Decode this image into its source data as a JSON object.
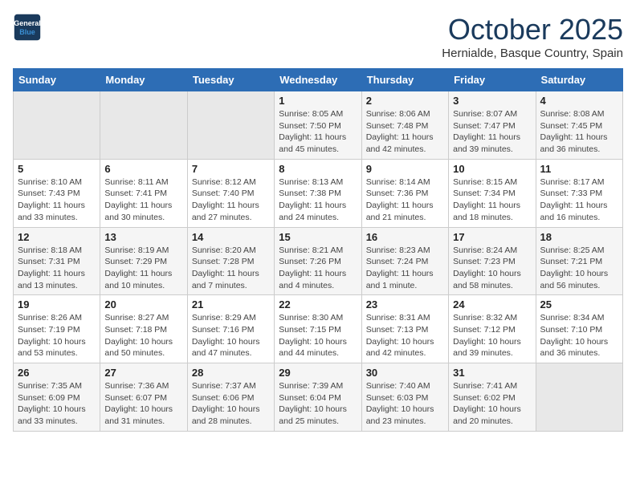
{
  "logo": {
    "line1": "General",
    "line2": "Blue"
  },
  "title": "October 2025",
  "subtitle": "Hernialde, Basque Country, Spain",
  "days_of_week": [
    "Sunday",
    "Monday",
    "Tuesday",
    "Wednesday",
    "Thursday",
    "Friday",
    "Saturday"
  ],
  "weeks": [
    [
      {
        "day": "",
        "info": ""
      },
      {
        "day": "",
        "info": ""
      },
      {
        "day": "",
        "info": ""
      },
      {
        "day": "1",
        "info": "Sunrise: 8:05 AM\nSunset: 7:50 PM\nDaylight: 11 hours\nand 45 minutes."
      },
      {
        "day": "2",
        "info": "Sunrise: 8:06 AM\nSunset: 7:48 PM\nDaylight: 11 hours\nand 42 minutes."
      },
      {
        "day": "3",
        "info": "Sunrise: 8:07 AM\nSunset: 7:47 PM\nDaylight: 11 hours\nand 39 minutes."
      },
      {
        "day": "4",
        "info": "Sunrise: 8:08 AM\nSunset: 7:45 PM\nDaylight: 11 hours\nand 36 minutes."
      }
    ],
    [
      {
        "day": "5",
        "info": "Sunrise: 8:10 AM\nSunset: 7:43 PM\nDaylight: 11 hours\nand 33 minutes."
      },
      {
        "day": "6",
        "info": "Sunrise: 8:11 AM\nSunset: 7:41 PM\nDaylight: 11 hours\nand 30 minutes."
      },
      {
        "day": "7",
        "info": "Sunrise: 8:12 AM\nSunset: 7:40 PM\nDaylight: 11 hours\nand 27 minutes."
      },
      {
        "day": "8",
        "info": "Sunrise: 8:13 AM\nSunset: 7:38 PM\nDaylight: 11 hours\nand 24 minutes."
      },
      {
        "day": "9",
        "info": "Sunrise: 8:14 AM\nSunset: 7:36 PM\nDaylight: 11 hours\nand 21 minutes."
      },
      {
        "day": "10",
        "info": "Sunrise: 8:15 AM\nSunset: 7:34 PM\nDaylight: 11 hours\nand 18 minutes."
      },
      {
        "day": "11",
        "info": "Sunrise: 8:17 AM\nSunset: 7:33 PM\nDaylight: 11 hours\nand 16 minutes."
      }
    ],
    [
      {
        "day": "12",
        "info": "Sunrise: 8:18 AM\nSunset: 7:31 PM\nDaylight: 11 hours\nand 13 minutes."
      },
      {
        "day": "13",
        "info": "Sunrise: 8:19 AM\nSunset: 7:29 PM\nDaylight: 11 hours\nand 10 minutes."
      },
      {
        "day": "14",
        "info": "Sunrise: 8:20 AM\nSunset: 7:28 PM\nDaylight: 11 hours\nand 7 minutes."
      },
      {
        "day": "15",
        "info": "Sunrise: 8:21 AM\nSunset: 7:26 PM\nDaylight: 11 hours\nand 4 minutes."
      },
      {
        "day": "16",
        "info": "Sunrise: 8:23 AM\nSunset: 7:24 PM\nDaylight: 11 hours\nand 1 minute."
      },
      {
        "day": "17",
        "info": "Sunrise: 8:24 AM\nSunset: 7:23 PM\nDaylight: 10 hours\nand 58 minutes."
      },
      {
        "day": "18",
        "info": "Sunrise: 8:25 AM\nSunset: 7:21 PM\nDaylight: 10 hours\nand 56 minutes."
      }
    ],
    [
      {
        "day": "19",
        "info": "Sunrise: 8:26 AM\nSunset: 7:19 PM\nDaylight: 10 hours\nand 53 minutes."
      },
      {
        "day": "20",
        "info": "Sunrise: 8:27 AM\nSunset: 7:18 PM\nDaylight: 10 hours\nand 50 minutes."
      },
      {
        "day": "21",
        "info": "Sunrise: 8:29 AM\nSunset: 7:16 PM\nDaylight: 10 hours\nand 47 minutes."
      },
      {
        "day": "22",
        "info": "Sunrise: 8:30 AM\nSunset: 7:15 PM\nDaylight: 10 hours\nand 44 minutes."
      },
      {
        "day": "23",
        "info": "Sunrise: 8:31 AM\nSunset: 7:13 PM\nDaylight: 10 hours\nand 42 minutes."
      },
      {
        "day": "24",
        "info": "Sunrise: 8:32 AM\nSunset: 7:12 PM\nDaylight: 10 hours\nand 39 minutes."
      },
      {
        "day": "25",
        "info": "Sunrise: 8:34 AM\nSunset: 7:10 PM\nDaylight: 10 hours\nand 36 minutes."
      }
    ],
    [
      {
        "day": "26",
        "info": "Sunrise: 7:35 AM\nSunset: 6:09 PM\nDaylight: 10 hours\nand 33 minutes."
      },
      {
        "day": "27",
        "info": "Sunrise: 7:36 AM\nSunset: 6:07 PM\nDaylight: 10 hours\nand 31 minutes."
      },
      {
        "day": "28",
        "info": "Sunrise: 7:37 AM\nSunset: 6:06 PM\nDaylight: 10 hours\nand 28 minutes."
      },
      {
        "day": "29",
        "info": "Sunrise: 7:39 AM\nSunset: 6:04 PM\nDaylight: 10 hours\nand 25 minutes."
      },
      {
        "day": "30",
        "info": "Sunrise: 7:40 AM\nSunset: 6:03 PM\nDaylight: 10 hours\nand 23 minutes."
      },
      {
        "day": "31",
        "info": "Sunrise: 7:41 AM\nSunset: 6:02 PM\nDaylight: 10 hours\nand 20 minutes."
      },
      {
        "day": "",
        "info": ""
      }
    ]
  ]
}
